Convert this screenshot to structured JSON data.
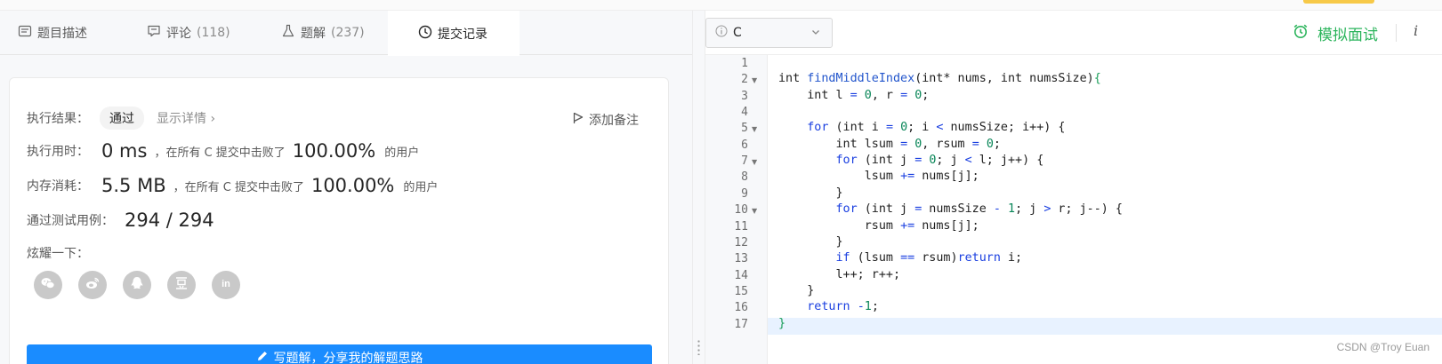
{
  "tabs": [
    {
      "label": "题目描述",
      "count": "",
      "icon": "description-icon"
    },
    {
      "label": "评论",
      "count": "(118)",
      "icon": "comment-icon"
    },
    {
      "label": "题解",
      "count": "(237)",
      "icon": "flask-icon"
    },
    {
      "label": "提交记录",
      "count": "",
      "icon": "clock-icon"
    }
  ],
  "result": {
    "label": "执行结果：",
    "status": "通过",
    "detail_link": "显示详情",
    "note_button": "添加备注"
  },
  "runtime": {
    "label": "执行用时：",
    "value": "0 ms",
    "beat_text": "，在所有 C 提交中击败了",
    "percent": "100.00%",
    "suffix": "的用户"
  },
  "memory": {
    "label": "内存消耗：",
    "value": "5.5 MB",
    "beat_text": "，在所有 C 提交中击败了",
    "percent": "100.00%",
    "suffix": "的用户"
  },
  "testcases": {
    "label": "通过测试用例：",
    "value": "294 / 294"
  },
  "share": {
    "label": "炫耀一下：",
    "platforms": [
      "wechat-icon",
      "weibo-icon",
      "qq-icon",
      "douban-icon",
      "linkedin-icon"
    ]
  },
  "write_solution": {
    "label": "写题解，分享我的解题思路"
  },
  "editor": {
    "language": "C",
    "mock_interview": "模拟面试",
    "info": "i",
    "lines": [
      "",
      "int findMiddleIndex(int* nums, int numsSize){",
      "    int l = 0, r = 0;",
      "",
      "    for (int i = 0; i < numsSize; i++) {",
      "        int lsum = 0, rsum = 0;",
      "        for (int j = 0; j < l; j++) {",
      "            lsum += nums[j];",
      "        }",
      "        for (int j = numsSize - 1; j > r; j--) {",
      "            rsum += nums[j];",
      "        }",
      "        if (lsum == rsum)return i;",
      "        l++; r++;",
      "    }",
      "    return -1;",
      "}"
    ],
    "fold_lines": [
      2,
      5,
      7,
      10
    ],
    "highlighted_line": 17
  },
  "watermark": "CSDN @Troy Euan",
  "colors": {
    "accent_blue": "#1a8cff",
    "accent_green": "#2db55d",
    "keyword": "#1a3fe0"
  }
}
